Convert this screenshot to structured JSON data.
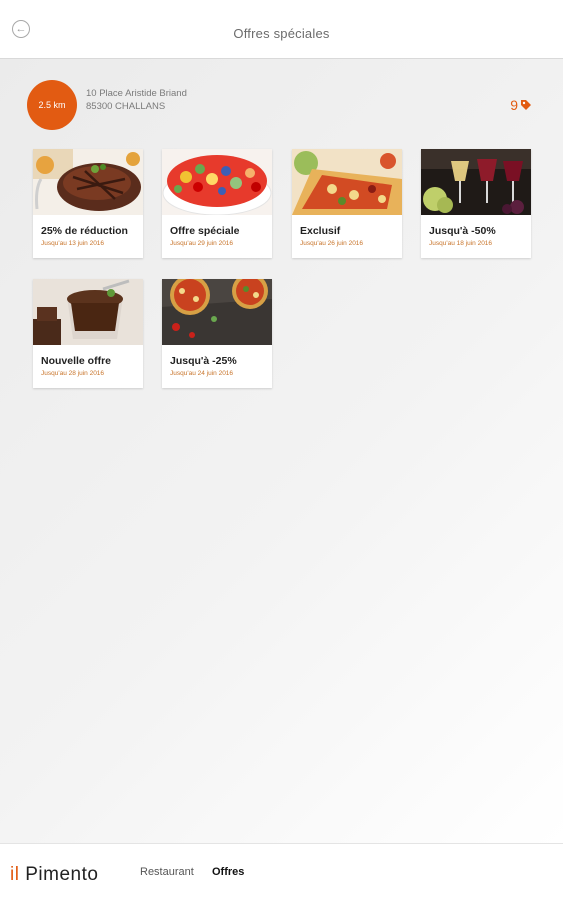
{
  "header": {
    "title": "Offres spéciales",
    "back_icon": "arrow-left-icon"
  },
  "location": {
    "distance": "2.5 km",
    "address_line1": "10 Place Aristide Briand",
    "address_line2": "85300 CHALLANS",
    "offers_count": "9",
    "count_icon": "tag-icon"
  },
  "offers": [
    {
      "title": "25% de réduction",
      "date": "Jusqu'au 13 juin 2016"
    },
    {
      "title": "Offre spéciale",
      "date": "Jusqu'au 29 juin 2016"
    },
    {
      "title": "Exclusif",
      "date": "Jusqu'au 26 juin 2016"
    },
    {
      "title": "Jusqu'à -50%",
      "date": "Jusqu'au 18 juin 2016"
    },
    {
      "title": "Nouvelle offre",
      "date": "Jusqu'au 28 juin 2016"
    },
    {
      "title": "Jusqu'à -25%",
      "date": "Jusqu'au 24 juin 2016"
    }
  ],
  "footer": {
    "logo_il": "il",
    "logo_name": "Pimento",
    "nav_restaurant": "Restaurant",
    "nav_offres": "Offres"
  },
  "colors": {
    "accent": "#e25b12",
    "date": "#c8742a"
  }
}
